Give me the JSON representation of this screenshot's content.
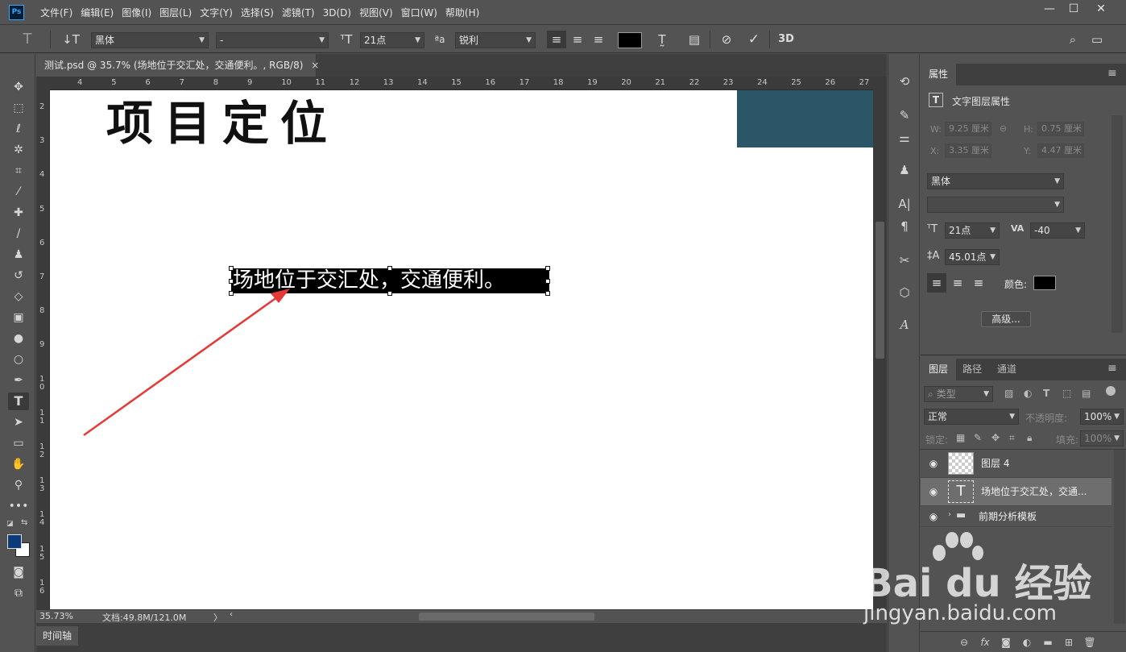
{
  "app": {
    "logo": "Ps",
    "menus": [
      "文件(F)",
      "编辑(E)",
      "图像(I)",
      "图层(L)",
      "文字(Y)",
      "选择(S)",
      "滤镜(T)",
      "3D(D)",
      "视图(V)",
      "窗口(W)",
      "帮助(H)"
    ],
    "window_controls": [
      "—",
      "☐",
      "✕"
    ]
  },
  "options_bar": {
    "font_family": "黑体",
    "font_style": "-",
    "font_size": "21点",
    "anti_alias": "锐利",
    "text_color": "#000000",
    "label_3d": "3D"
  },
  "document": {
    "tab_title": "测试.psd @ 35.7% (场地位于交汇处，交通便利。, RGB/8)",
    "close": "×",
    "heading": "项目定位",
    "selected_text": "场地位于交汇处，交通便利。",
    "accent_color": "#2b5667",
    "arrow_color": "#e53935",
    "ruler_top": [
      "4",
      "5",
      "6",
      "7",
      "8",
      "9",
      "10",
      "11",
      "12",
      "13",
      "14",
      "15",
      "16",
      "17",
      "18",
      "19",
      "20",
      "21",
      "22",
      "23",
      "24",
      "25",
      "26",
      "27"
    ],
    "ruler_left": [
      "2",
      "3",
      "4",
      "5",
      "6",
      "7",
      "8",
      "9",
      "1\n0",
      "1\n1",
      "1\n2",
      "1\n3",
      "1\n4",
      "1\n5",
      "1\n6"
    ]
  },
  "status": {
    "zoom": "35.73%",
    "doc_size": "文档:49.8M/121.0M",
    "expand": "〉"
  },
  "timeline": {
    "tab": "时间轴"
  },
  "properties": {
    "tab": "属性",
    "section_title": "文字图层属性",
    "w_label": "W:",
    "w_value": "9.25 厘米",
    "h_label": "H:",
    "h_value": "0.75 厘米",
    "x_label": "X:",
    "x_value": "3.35 厘米",
    "y_label": "Y:",
    "y_value": "4.47 厘米",
    "font_family": "黑体",
    "font_style": "",
    "font_size": "21点",
    "tracking": "-40",
    "leading": "45.01点",
    "color_label": "颜色:",
    "color": "#000000",
    "advanced_button": "高级..."
  },
  "layers": {
    "tabs": [
      "图层",
      "路径",
      "通道"
    ],
    "filter_kind": "类型",
    "blend_mode": "正常",
    "opacity_label": "不透明度:",
    "opacity": "100%",
    "lock_label": "锁定:",
    "fill_label": "填充:",
    "fill": "100%",
    "items": [
      {
        "name": "图层 4",
        "type": "pixel"
      },
      {
        "name": "场地位于交汇处，交通...",
        "type": "text"
      },
      {
        "name": "前期分析模板",
        "type": "group"
      }
    ],
    "bottom_icons": [
      "link-icon",
      "fx-icon",
      "mask-icon",
      "adjustment-icon",
      "group-icon",
      "new-layer-icon",
      "delete-icon"
    ]
  },
  "watermark": {
    "text": "Bai du 经验",
    "url": "jingyan.baidu.com"
  }
}
